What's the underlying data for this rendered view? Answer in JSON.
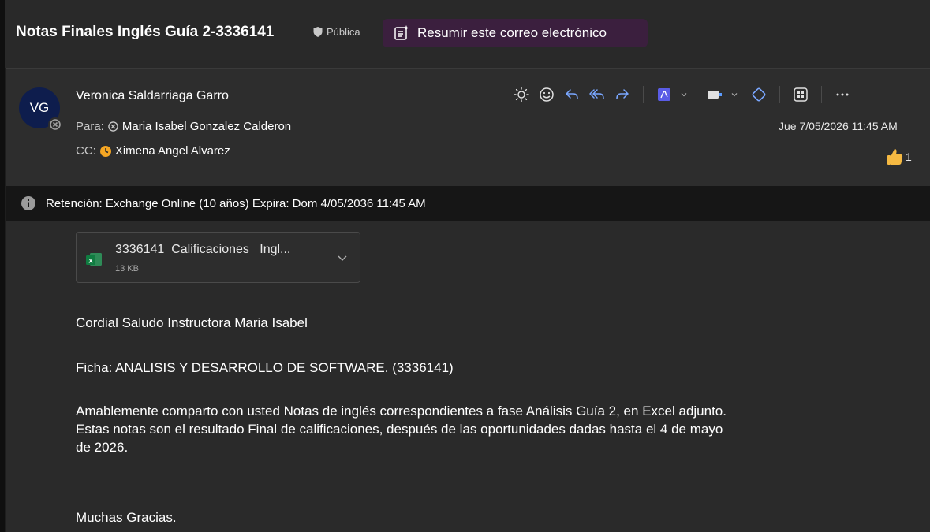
{
  "header": {
    "subject": "Notas Finales Inglés Guía 2-3336141",
    "sensitivity": "Pública",
    "summarize_label": "Resumir este correo electrónico"
  },
  "message": {
    "avatar_initials": "VG",
    "sender": "Veronica Saldarriaga Garro",
    "to_label": "Para:",
    "to_name": "Maria Isabel Gonzalez Calderon",
    "cc_label": "CC:",
    "cc_name": "Ximena Angel Alvarez",
    "date": "Jue 7/05/2026 11:45 AM",
    "reaction_count": "1"
  },
  "toolbar": {
    "icons": [
      "sun-icon",
      "emoji-icon",
      "reply-icon",
      "reply-all-icon",
      "forward-icon",
      "pdf-icon",
      "chevron-down-icon",
      "rules-icon",
      "chevron-down-icon",
      "loop-icon",
      "apps-icon",
      "more-icon"
    ]
  },
  "retention": {
    "text": "Retención: Exchange Online (10 años) Expira: Dom 4/05/2036 11:45 AM"
  },
  "attachment": {
    "name": "3336141_Calificaciones_ Ingl...",
    "size": "13 KB"
  },
  "body": {
    "greeting": "Cordial Saludo Instructora Maria Isabel",
    "ficha": "Ficha: ANALISIS Y DESARROLLO DE SOFTWARE. (3336141)",
    "para_line1": "Amablemente comparto con usted Notas de inglés correspondientes a fase Análisis Guía 2, en Excel adjunto.",
    "para_line2": "Estas notas son el resultado Final de calificaciones, después de las oportunidades dadas hasta el 4 de  mayo",
    "para_line3": "de 2026.",
    "closing": "Muchas Gracias."
  },
  "colors": {
    "background": "#1e1e1e",
    "card": "#2d2d2d",
    "summarize_bg": "#3b1f3e",
    "avatar_bg": "#0e1d4d",
    "accent_blue": "#5b9bff",
    "reaction_yellow": "#f5b942",
    "cc_status_orange": "#f5a623"
  }
}
